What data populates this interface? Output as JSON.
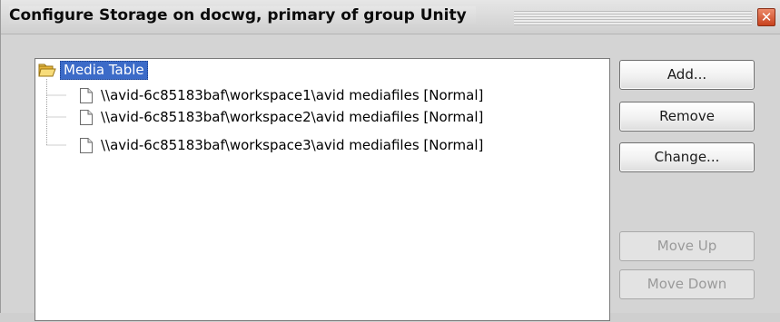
{
  "window": {
    "title": "Configure Storage on docwg, primary of group Unity",
    "close_glyph": "✕",
    "close_color": "#d2502a"
  },
  "tree": {
    "root_label": "Media Table",
    "root_icon": "folder-icon",
    "selection_color": "#3c6bc8",
    "items": [
      {
        "label": "\\\\avid-6c85183baf\\workspace1\\avid mediafiles [Normal]",
        "icon": "file-icon"
      },
      {
        "label": "\\\\avid-6c85183baf\\workspace2\\avid mediafiles [Normal]",
        "icon": "file-icon"
      },
      {
        "label": "\\\\avid-6c85183baf\\workspace3\\avid mediafiles [Normal]",
        "icon": "file-icon"
      }
    ]
  },
  "buttons": {
    "add": "Add...",
    "remove": "Remove",
    "change": "Change...",
    "move_up": "Move Up",
    "move_down": "Move Down"
  }
}
